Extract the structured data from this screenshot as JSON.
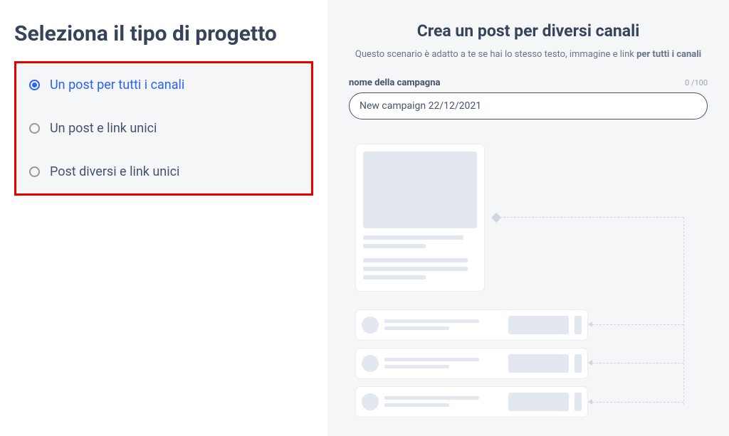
{
  "left": {
    "title": "Seleziona il tipo di progetto",
    "options": [
      {
        "label": "Un post per tutti i canali",
        "selected": true
      },
      {
        "label": "Un post e link unici",
        "selected": false
      },
      {
        "label": "Post diversi e link unici",
        "selected": false
      }
    ]
  },
  "right": {
    "title": "Crea un post per diversi canali",
    "subtitle_prefix": "Questo scenario è adatto a te se hai lo stesso testo, immagine e link ",
    "subtitle_bold": "per tutti i canali",
    "campaign": {
      "label": "nome della campagna",
      "counter": "0 /100",
      "value": "New campaign 22/12/2021"
    }
  }
}
